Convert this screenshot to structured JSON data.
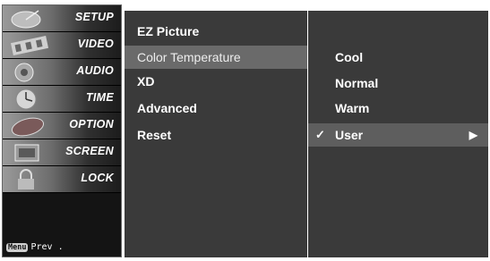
{
  "sidebar": {
    "categories": [
      {
        "label": "SETUP",
        "icon": "satellite-dish-icon"
      },
      {
        "label": "VIDEO",
        "icon": "film-strip-icon"
      },
      {
        "label": "AUDIO",
        "icon": "speaker-icon"
      },
      {
        "label": "TIME",
        "icon": "clock-icon"
      },
      {
        "label": "OPTION",
        "icon": "option-tag-icon"
      },
      {
        "label": "SCREEN",
        "icon": "screen-icon"
      },
      {
        "label": "LOCK",
        "icon": "lock-icon"
      }
    ],
    "footer": {
      "key": "Menu",
      "text": "Prev ."
    }
  },
  "submenu": {
    "items": [
      {
        "label": "EZ Picture"
      },
      {
        "label": "Color Temperature",
        "selected": true
      },
      {
        "label": "XD"
      },
      {
        "label": "Advanced"
      },
      {
        "label": "Reset"
      }
    ]
  },
  "options": {
    "items": [
      {
        "label": "Cool"
      },
      {
        "label": "Normal"
      },
      {
        "label": "Warm"
      },
      {
        "label": "User",
        "checked": true,
        "selected": true,
        "check_glyph": "✓",
        "arrow_glyph": "▶"
      }
    ]
  },
  "colors": {
    "panel": "#3a3a3a",
    "submenu_highlight": "#6a6a6a",
    "option_highlight": "#5e5e5e",
    "sidebar": "#141414",
    "text": "#ffffff"
  }
}
